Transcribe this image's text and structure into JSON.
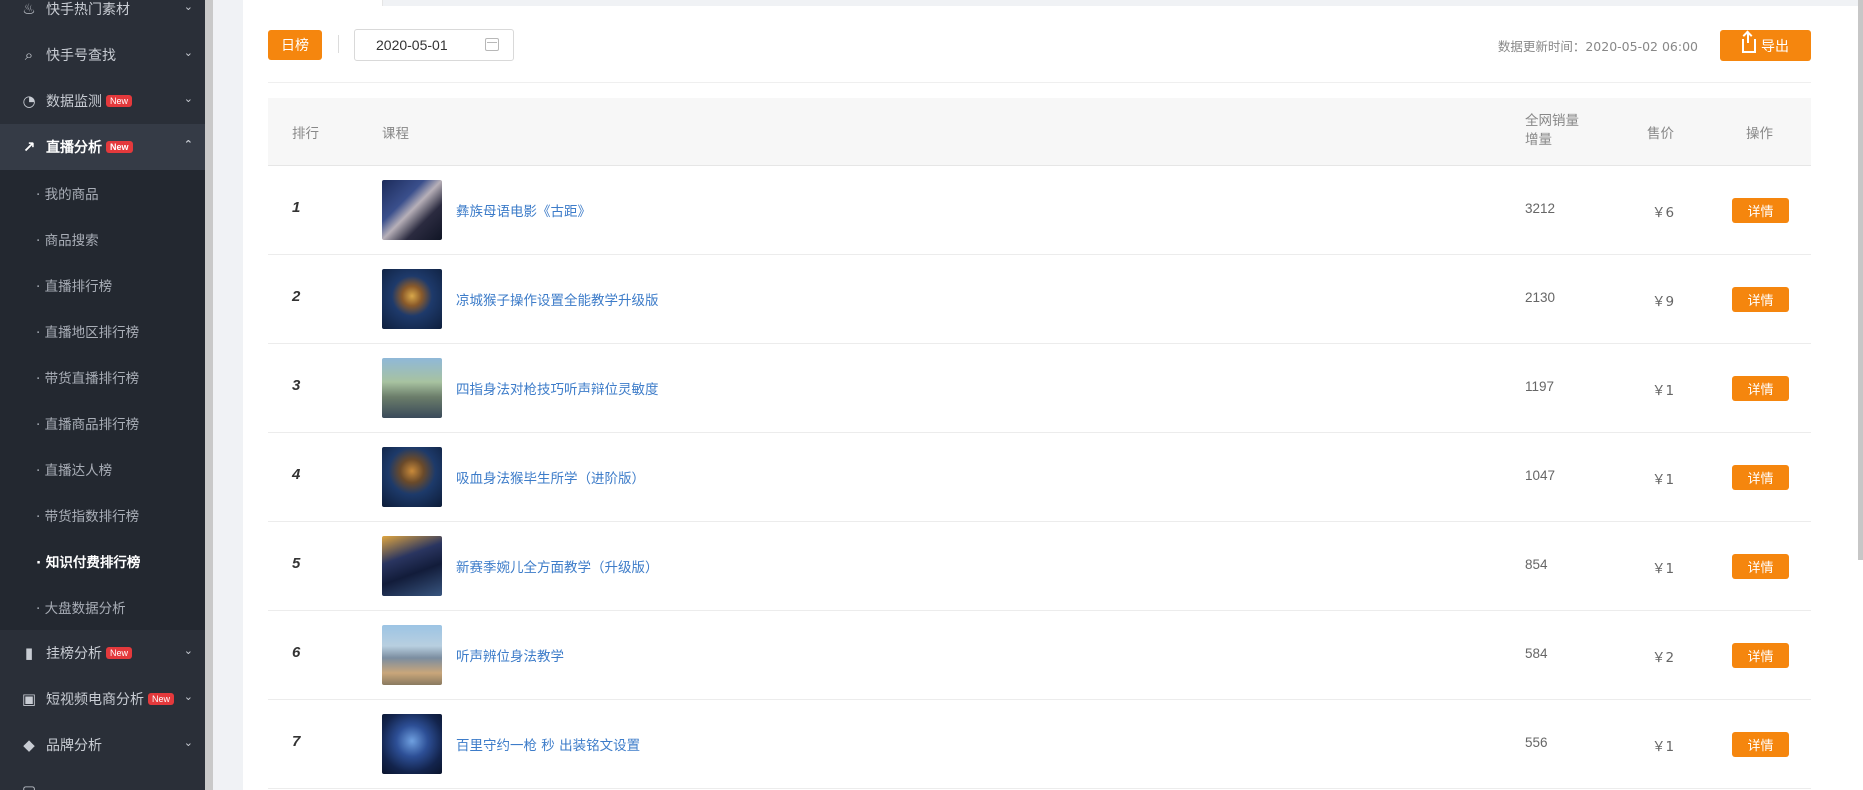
{
  "sidebar": {
    "menu": [
      {
        "label": "快手热门素材",
        "icon": "fire-icon",
        "glyph": "♨",
        "badge": ""
      },
      {
        "label": "快手号查找",
        "icon": "search-icon",
        "glyph": "⌕",
        "badge": ""
      },
      {
        "label": "数据监测",
        "icon": "monitor-icon",
        "glyph": "◔",
        "badge": "New"
      },
      {
        "label": "直播分析",
        "icon": "trend-icon",
        "glyph": "↗",
        "badge": "New"
      }
    ],
    "submenu": [
      {
        "label": "· 我的商品"
      },
      {
        "label": "· 商品搜索"
      },
      {
        "label": "· 直播排行榜"
      },
      {
        "label": "· 直播地区排行榜"
      },
      {
        "label": "· 带货直播排行榜"
      },
      {
        "label": "· 直播商品排行榜"
      },
      {
        "label": "· 直播达人榜"
      },
      {
        "label": "· 带货指数排行榜"
      },
      {
        "label": "· 知识付费排行榜"
      },
      {
        "label": "· 大盘数据分析"
      }
    ],
    "menu_bottom": [
      {
        "label": "挂榜分析",
        "icon": "bar-chart-icon",
        "glyph": "▮",
        "badge": "New"
      },
      {
        "label": "短视频电商分析",
        "icon": "shopping-bag-icon",
        "glyph": "▣",
        "badge": "New"
      },
      {
        "label": "品牌分析",
        "icon": "diamond-icon",
        "glyph": "◆",
        "badge": ""
      }
    ],
    "chevron_down": "⌄",
    "chevron_up": "⌃"
  },
  "toolbar": {
    "day_label": "日榜",
    "date_value": "2020-05-01",
    "update_time": "数据更新时间：2020-05-02 06:00",
    "export_label": "导出"
  },
  "table": {
    "headers": {
      "rank": "排行",
      "course": "课程",
      "sales": "全网销量增量",
      "price": "售价",
      "action": "操作"
    },
    "rows": [
      {
        "rank": "1",
        "course": "彝族母语电影《古距》",
        "sales": "3212",
        "price": "￥6",
        "action": "详情"
      },
      {
        "rank": "2",
        "course": "凉城猴子操作设置全能教学升级版",
        "sales": "2130",
        "price": "￥9",
        "action": "详情"
      },
      {
        "rank": "3",
        "course": "四指身法对枪技巧听声辩位灵敏度",
        "sales": "1197",
        "price": "￥1",
        "action": "详情"
      },
      {
        "rank": "4",
        "course": "吸血身法猴毕生所学（进阶版）",
        "sales": "1047",
        "price": "￥1",
        "action": "详情"
      },
      {
        "rank": "5",
        "course": "新赛季婉儿全方面教学（升级版）",
        "sales": "854",
        "price": "￥1",
        "action": "详情"
      },
      {
        "rank": "6",
        "course": "听声辨位身法教学",
        "sales": "584",
        "price": "￥2",
        "action": "详情"
      },
      {
        "rank": "7",
        "course": "百里守约一枪 秒 出装铭文设置",
        "sales": "556",
        "price": "￥1",
        "action": "详情"
      }
    ]
  },
  "colors": {
    "accent": "#f5860e",
    "sidebar_bg": "#2a2f38",
    "link": "#3d7cc9",
    "badge": "#e4393c"
  }
}
